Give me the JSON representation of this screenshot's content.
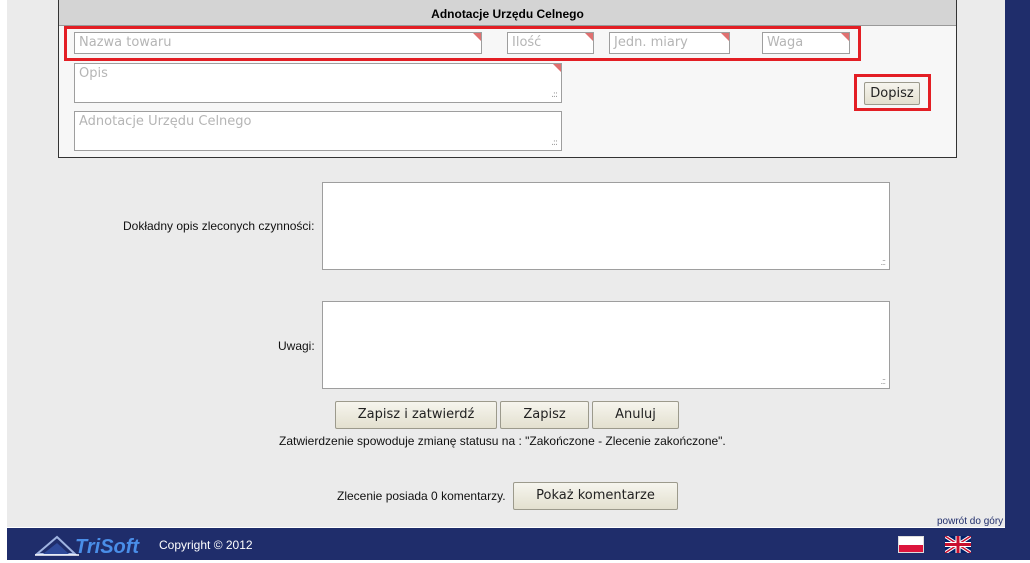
{
  "panel": {
    "title": "Adnotacje Urzędu Celnego"
  },
  "fields": {
    "nazwa_towaru": "Nazwa towaru",
    "ilosc": "Ilość",
    "jedn_miary": "Jedn. miary",
    "waga": "Waga",
    "opis": "Opis",
    "adnotacje": "Adnotacje Urzędu Celnego"
  },
  "buttons": {
    "dopisz": "Dopisz",
    "zapisz_zatwierdz": "Zapisz i zatwierdź",
    "zapisz": "Zapisz",
    "anuluj": "Anuluj",
    "pokaz_komentarze": "Pokaż komentarze"
  },
  "form": {
    "opis_label": "Dokładny opis zleconych czynności:",
    "uwagi_label": "Uwagi:",
    "status_note": "Zatwierdzenie spowoduje zmianę statusu na : \"Zakończone - Zlecenie zakończone\".",
    "comments_note": "Zlecenie posiada 0 komentarzy."
  },
  "footer": {
    "brand": "TriSoft",
    "copyright": "Copyright © 2012",
    "back_to_top": "powrót do góry"
  },
  "colors": {
    "navy": "#1f2d6b",
    "highlight": "#e31e24",
    "required_marker": "#e07070"
  }
}
